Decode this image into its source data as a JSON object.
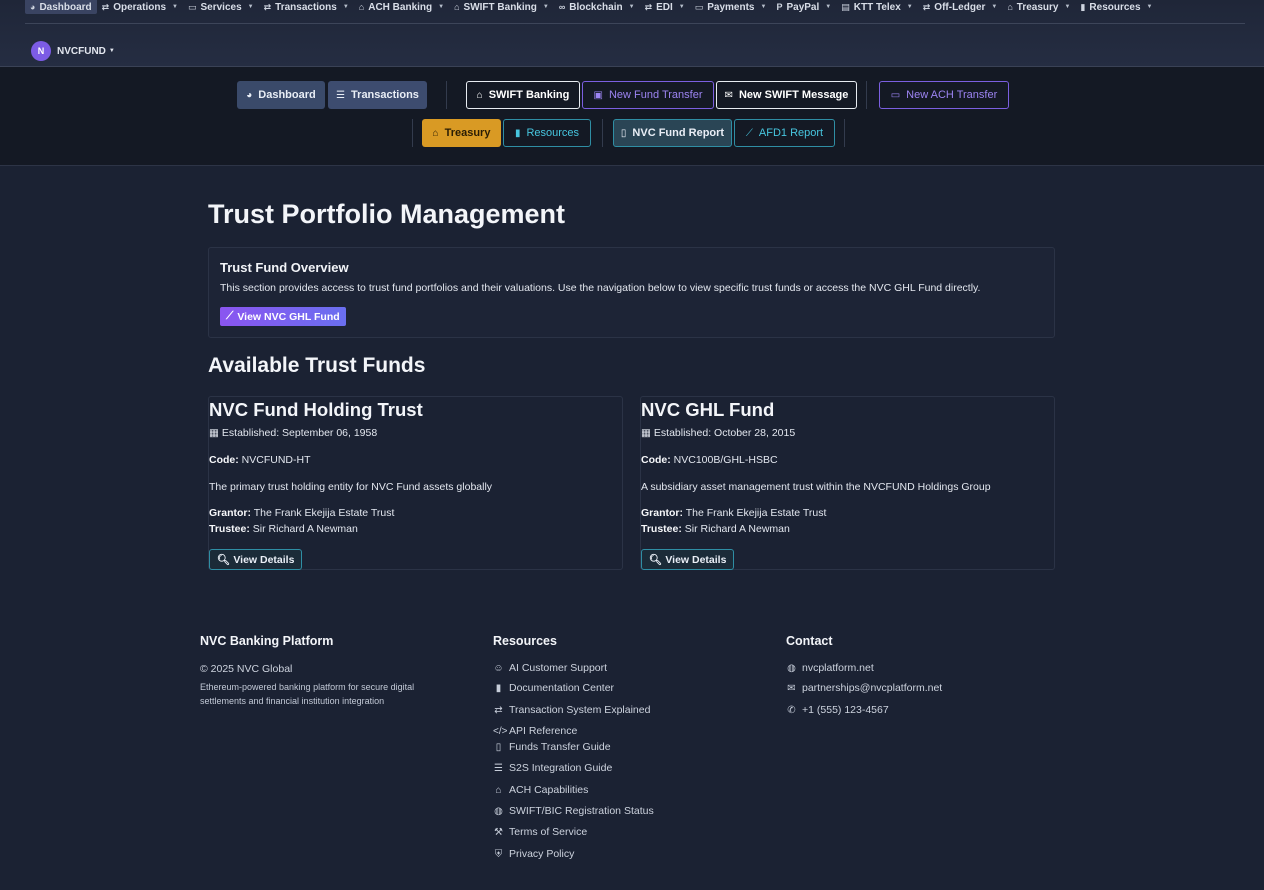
{
  "topnav": {
    "items": [
      {
        "label": "Dashboard",
        "icon": "dashboard-icon",
        "caret": false
      },
      {
        "label": "Operations",
        "icon": "exchange-icon",
        "caret": true
      },
      {
        "label": "Services",
        "icon": "card-icon",
        "caret": true
      },
      {
        "label": "Transactions",
        "icon": "exchange-icon",
        "caret": true
      },
      {
        "label": "ACH Banking",
        "icon": "bank-icon",
        "caret": true
      },
      {
        "label": "SWIFT Banking",
        "icon": "bank-icon",
        "caret": true
      },
      {
        "label": "Blockchain",
        "icon": "link-icon",
        "caret": true
      },
      {
        "label": "EDI",
        "icon": "exchange-icon",
        "caret": true
      },
      {
        "label": "Payments",
        "icon": "card-icon",
        "caret": true
      },
      {
        "label": "PayPal",
        "icon": "paypal-icon",
        "caret": true
      },
      {
        "label": "KTT Telex",
        "icon": "fax-icon",
        "caret": true
      },
      {
        "label": "Off-Ledger",
        "icon": "exchange-icon",
        "caret": true
      },
      {
        "label": "Treasury",
        "icon": "bank-icon",
        "caret": true
      },
      {
        "label": "Resources",
        "icon": "book-icon",
        "caret": true
      }
    ],
    "user": {
      "initial": "N",
      "name": "NVCFUND"
    }
  },
  "quickbar": {
    "dashboard": "Dashboard",
    "transactions": "Transactions",
    "swift_banking": "SWIFT Banking",
    "new_fund_transfer": "New Fund Transfer",
    "new_swift_message": "New SWIFT Message",
    "new_ach_transfer": "New ACH Transfer",
    "treasury": "Treasury",
    "resources": "Resources",
    "nvc_fund_report": "NVC Fund Report",
    "afd1_report": "AFD1 Report"
  },
  "main": {
    "title": "Trust Portfolio Management",
    "overview": {
      "title": "Trust Fund Overview",
      "description": "This section provides access to trust fund portfolios and their valuations. Use the navigation below to view specific trust funds or access the NVC GHL Fund directly.",
      "button": "View NVC GHL Fund"
    },
    "funds_title": "Available Trust Funds",
    "funds": [
      {
        "name": "NVC Fund Holding Trust",
        "established": "Established: September 06, 1958",
        "code_label": "Code:",
        "code": "NVCFUND-HT",
        "description": "The primary trust holding entity for NVC Fund assets globally",
        "grantor_label": "Grantor:",
        "grantor": "The Frank Ekejija Estate Trust",
        "trustee_label": "Trustee:",
        "trustee": "Sir Richard A Newman",
        "button": "View Details"
      },
      {
        "name": "NVC GHL Fund",
        "established": "Established: October 28, 2015",
        "code_label": "Code:",
        "code": "NVC100B/GHL-HSBC",
        "description": "A subsidiary asset management trust within the NVCFUND Holdings Group",
        "grantor_label": "Grantor:",
        "grantor": "The Frank Ekejija Estate Trust",
        "trustee_label": "Trustee:",
        "trustee": "Sir Richard A Newman",
        "button": "View Details"
      }
    ]
  },
  "footer": {
    "brand": {
      "title": "NVC Banking Platform",
      "copyright": "© 2025 NVC Global",
      "description": "Ethereum-powered banking platform for secure digital settlements and financial institution integration"
    },
    "resources": {
      "title": "Resources",
      "links": [
        {
          "label": "AI Customer Support",
          "icon": "robot-icon"
        },
        {
          "label": "Documentation Center",
          "icon": "book-icon"
        },
        {
          "label": "Transaction System Explained",
          "icon": "exchange-icon"
        },
        {
          "label": "API Reference",
          "icon": "code-icon"
        },
        {
          "label": "Funds Transfer Guide",
          "icon": "file-icon"
        },
        {
          "label": "S2S Integration Guide",
          "icon": "server-icon"
        },
        {
          "label": "ACH Capabilities",
          "icon": "bank-icon"
        },
        {
          "label": "SWIFT/BIC Registration Status",
          "icon": "globe-icon"
        },
        {
          "label": "Terms of Service",
          "icon": "gavel-icon"
        },
        {
          "label": "Privacy Policy",
          "icon": "shield-icon"
        }
      ]
    },
    "contact": {
      "title": "Contact",
      "items": [
        {
          "label": "nvcplatform.net",
          "icon": "globe-icon"
        },
        {
          "label": "partnerships@nvcplatform.net",
          "icon": "envelope-icon"
        },
        {
          "label": "+1 (555) 123-4567",
          "icon": "phone-icon"
        }
      ]
    }
  }
}
